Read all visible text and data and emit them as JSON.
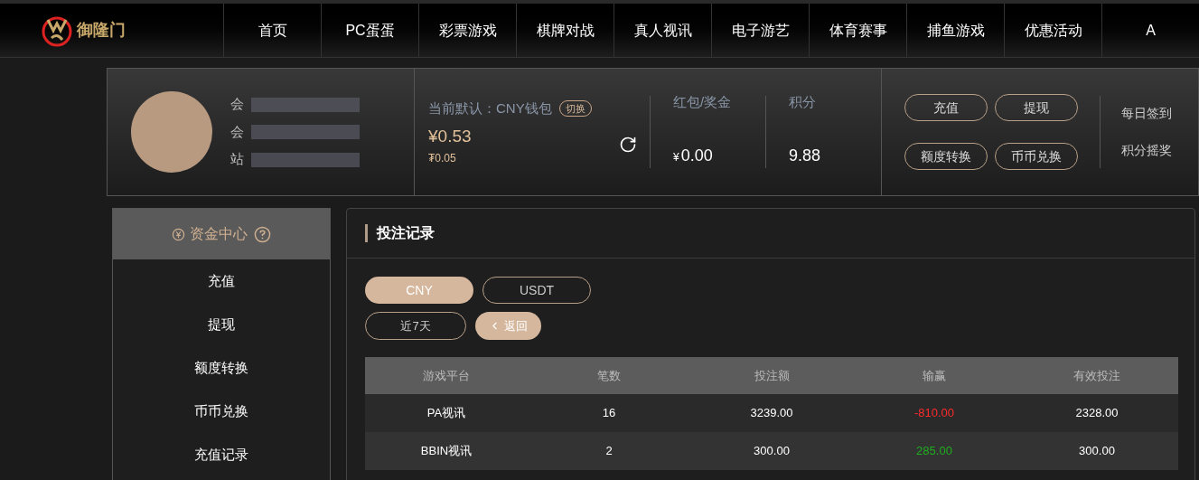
{
  "logo": {
    "text": "御隆门"
  },
  "nav": [
    {
      "label": "首页"
    },
    {
      "label": "PC蛋蛋"
    },
    {
      "label": "彩票游戏"
    },
    {
      "label": "棋牌对战"
    },
    {
      "label": "真人视讯"
    },
    {
      "label": "电子游艺"
    },
    {
      "label": "体育赛事"
    },
    {
      "label": "捕鱼游戏"
    },
    {
      "label": "优惠活动"
    },
    {
      "label": "A"
    }
  ],
  "profile": {
    "fields": [
      "会",
      "会",
      "站"
    ]
  },
  "wallet": {
    "label": "当前默认：CNY钱包",
    "switch": "切换",
    "balance": "¥0.53",
    "sub_balance": "₮0.05"
  },
  "stats": [
    {
      "label": "红包/奖金",
      "currency": "¥",
      "value": "0.00"
    },
    {
      "label": "积分",
      "value": "9.88"
    }
  ],
  "actions": [
    "充值",
    "提现",
    "额度转换",
    "币币兑换"
  ],
  "links": [
    "每日签到",
    "积分摇奖"
  ],
  "sidebar": {
    "title": "资金中心",
    "items": [
      "充值",
      "提现",
      "额度转换",
      "币币兑换",
      "充值记录"
    ]
  },
  "panel": {
    "title": "投注记录",
    "currencies": [
      {
        "label": "CNY",
        "selected": true
      },
      {
        "label": "USDT",
        "selected": false
      }
    ],
    "period": "近7天",
    "back": "返回",
    "table": {
      "columns": [
        "游戏平台",
        "笔数",
        "投注额",
        "输赢",
        "有效投注"
      ],
      "rows": [
        {
          "cells": [
            "PA视讯",
            "16",
            "3239.00",
            "-810.00",
            "2328.00"
          ],
          "color": "#ff2a2a"
        },
        {
          "cells": [
            "BBIN视讯",
            "2",
            "300.00",
            "285.00",
            "300.00"
          ],
          "color": "#1fae1f"
        }
      ]
    }
  }
}
